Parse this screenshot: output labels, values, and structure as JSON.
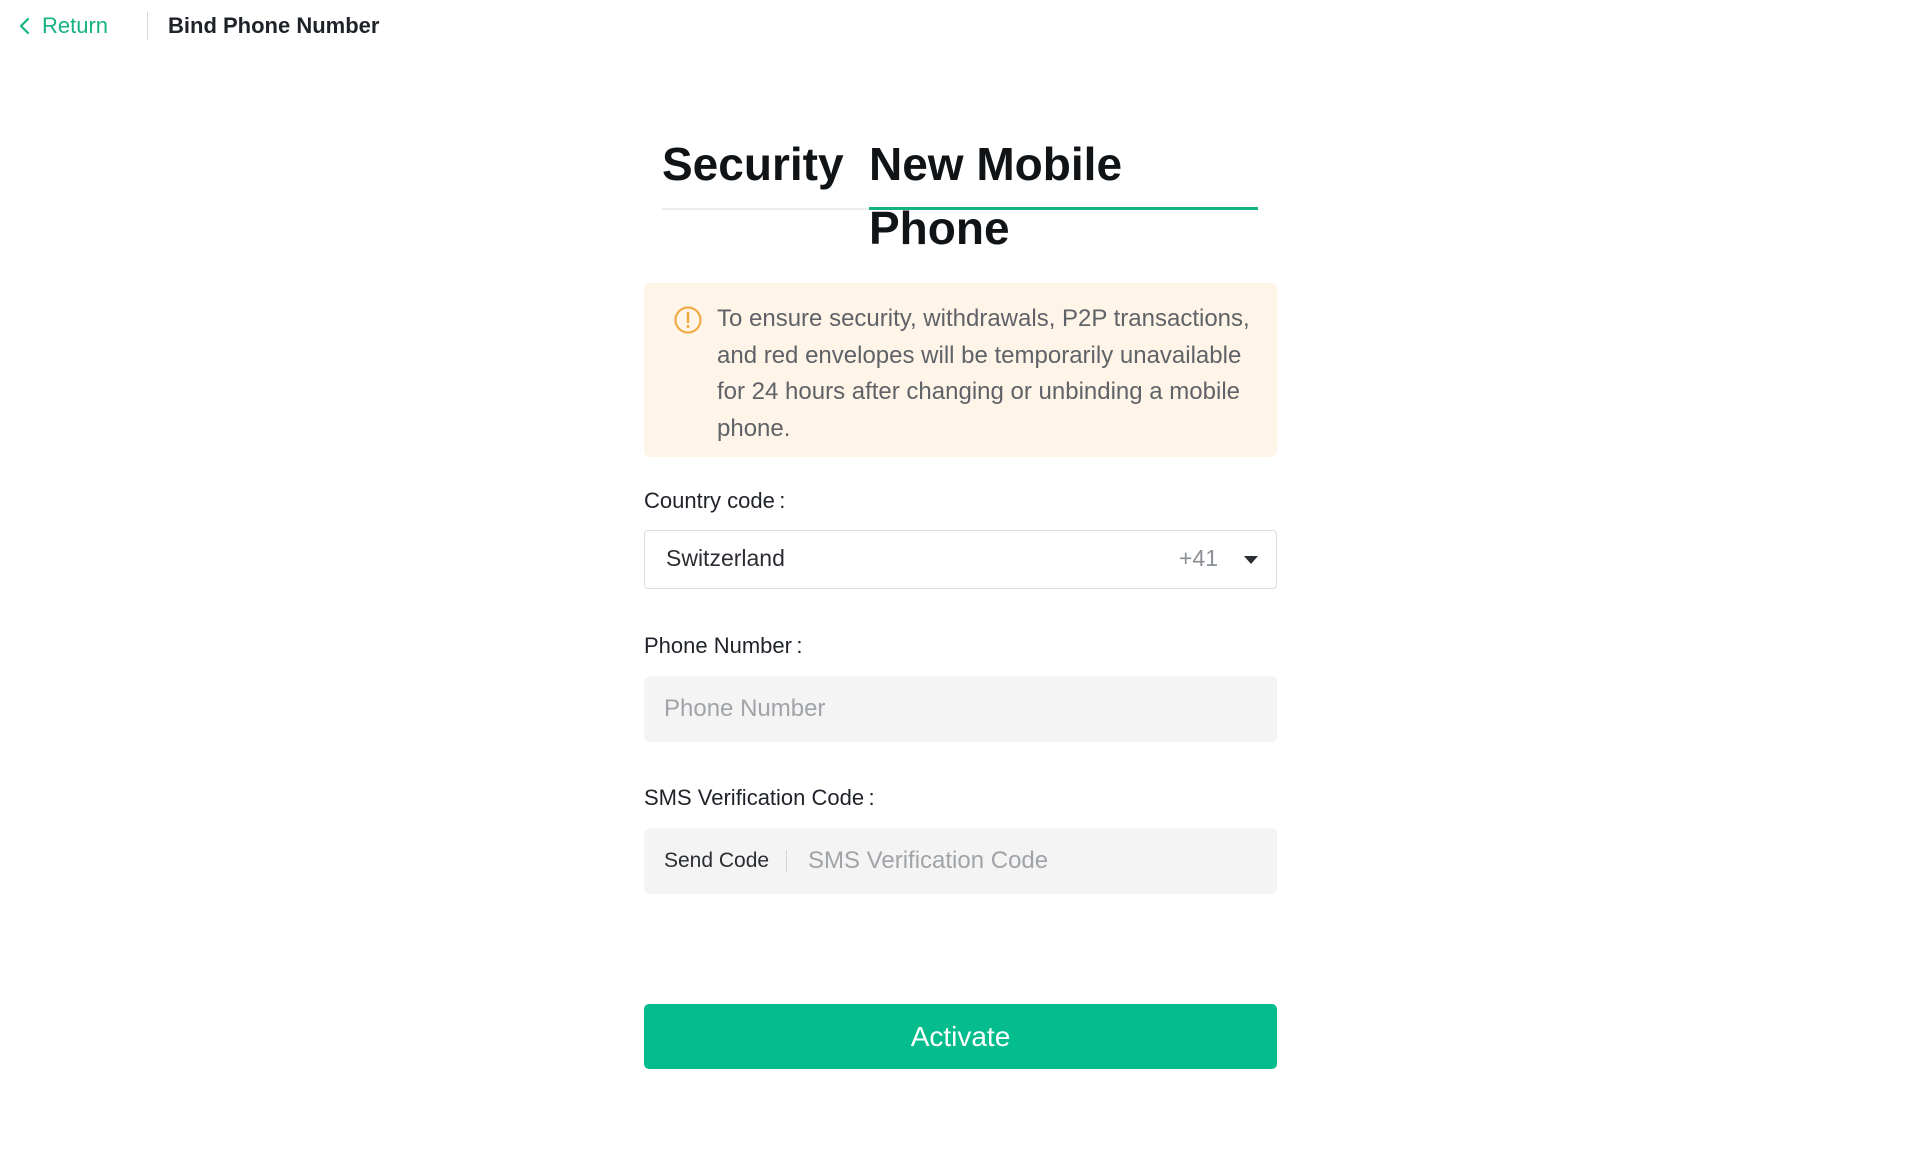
{
  "header": {
    "return_label": "Return",
    "title": "Bind Phone Number"
  },
  "tabs": [
    {
      "label": "Security",
      "active": false
    },
    {
      "label": "New Mobile Phone",
      "active": true
    }
  ],
  "warning": {
    "icon": "exclamation-circle-icon",
    "text": "To ensure security, withdrawals, P2P transactions, and red envelopes will be temporarily unavailable for 24 hours after changing or unbinding a mobile phone."
  },
  "form": {
    "country_label": "Country code :",
    "country_value": "Switzerland",
    "country_code": "+41",
    "phone_label": "Phone Number :",
    "phone_placeholder": "Phone Number",
    "sms_label": "SMS Verification Code :",
    "send_code_label": "Send Code",
    "sms_placeholder": "SMS Verification Code",
    "submit_label": "Activate"
  },
  "colors": {
    "accent": "#15b383",
    "button": "#05bc8c",
    "warning_bg": "#fff4e8",
    "warning_icon": "#f0a53a"
  }
}
